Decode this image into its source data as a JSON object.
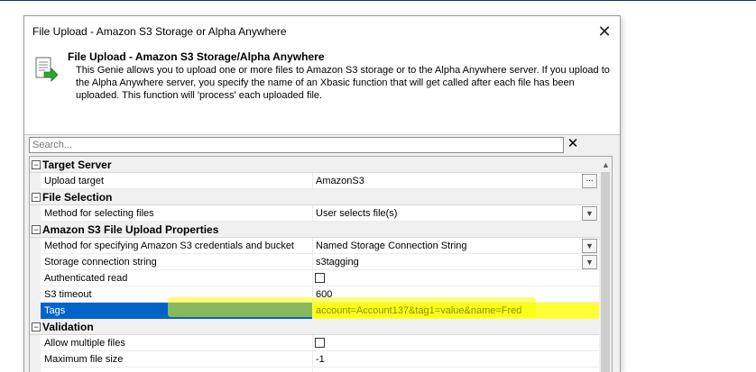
{
  "window": {
    "title": "File Upload - Amazon S3 Storage or Alpha Anywhere"
  },
  "header": {
    "title": "File Upload - Amazon S3 Storage/Alpha Anywhere",
    "description": "This Genie allows you to upload one or more files to Amazon S3 storage or to the Alpha Anywhere server. If you upload to the Alpha Anywhere server, you specify the name of an Xbasic function that will get called after each file has been uploaded. This function will 'process' each uploaded file.",
    "icon": "document-arrow-icon"
  },
  "search": {
    "placeholder": "Search...",
    "clear_label": "✕"
  },
  "categories": {
    "target_server": "Target Server",
    "file_selection": "File Selection",
    "s3_props": "Amazon S3 File Upload Properties",
    "validation": "Validation"
  },
  "props": {
    "upload_target": {
      "name": "Upload target",
      "value": "AmazonS3"
    },
    "method_select": {
      "name": "Method for selecting files",
      "value": "User selects file(s)"
    },
    "credentials_method": {
      "name": "Method for specifying Amazon S3 credentials and bucket",
      "value": "Named Storage Connection String"
    },
    "storage_conn": {
      "name": "Storage connection string",
      "value": "s3tagging"
    },
    "auth_read": {
      "name": "Authenticated read"
    },
    "s3_timeout": {
      "name": "S3 timeout",
      "value": "600"
    },
    "tags": {
      "name": "Tags",
      "value": "account=Account137&tag1=value&name=Fred"
    },
    "allow_multiple": {
      "name": "Allow multiple files"
    },
    "max_size": {
      "name": "Maximum file size",
      "value": "-1"
    }
  },
  "colors": {
    "selection": "#0063c8",
    "highlight": "#ffff35"
  }
}
